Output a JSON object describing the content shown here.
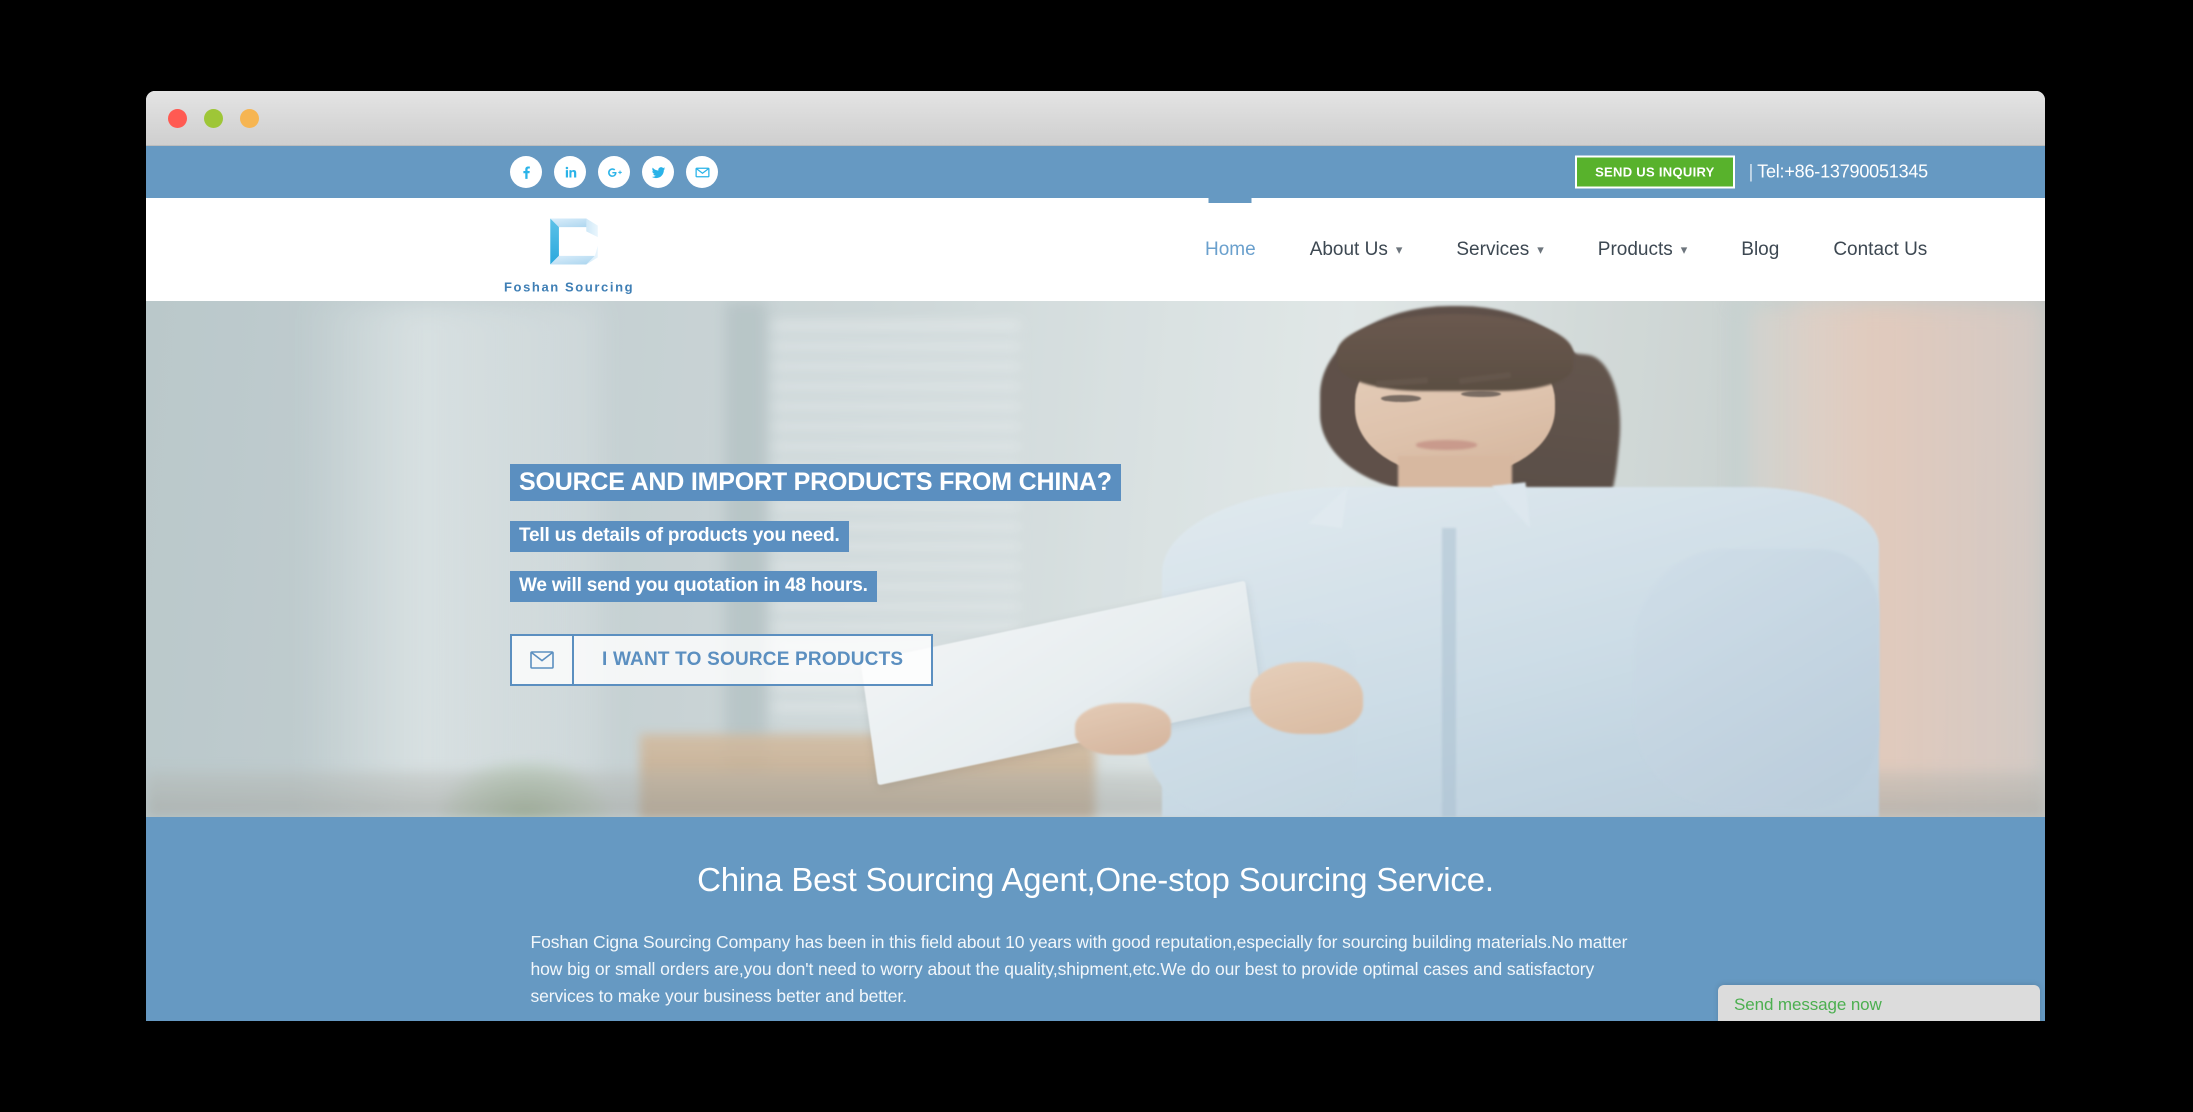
{
  "window": {
    "traffic_lights": [
      "close",
      "minimize",
      "maximize"
    ]
  },
  "topbar": {
    "social": [
      {
        "name": "facebook-icon",
        "label": "Facebook"
      },
      {
        "name": "linkedin-icon",
        "label": "LinkedIn"
      },
      {
        "name": "googleplus-icon",
        "label": "Google Plus"
      },
      {
        "name": "twitter-icon",
        "label": "Twitter"
      },
      {
        "name": "email-icon",
        "label": "Email"
      }
    ],
    "inquiry_button": "SEND US INQUIRY",
    "tel_separator": "|",
    "tel": "Tel:+86-13790051345"
  },
  "header": {
    "logo_text": "Foshan Sourcing",
    "nav": [
      {
        "label": "Home",
        "active": true,
        "dropdown": false
      },
      {
        "label": "About Us",
        "active": false,
        "dropdown": true
      },
      {
        "label": "Services",
        "active": false,
        "dropdown": true
      },
      {
        "label": "Products",
        "active": false,
        "dropdown": true
      },
      {
        "label": "Blog",
        "active": false,
        "dropdown": false
      },
      {
        "label": "Contact Us",
        "active": false,
        "dropdown": false
      }
    ]
  },
  "hero": {
    "headline": "SOURCE AND IMPORT PRODUCTS FROM CHINA?",
    "subline_1": "Tell us details of products you need.",
    "subline_2": "We will send you quotation in 48 hours.",
    "cta_label": "I WANT TO SOURCE PRODUCTS",
    "cta_icon": "envelope-icon",
    "image_alt": "Businesswoman in light blue shirt holding a white tablet in a bright office"
  },
  "intro": {
    "title": "China Best Sourcing Agent,One-stop Sourcing Service.",
    "body": "Foshan Cigna Sourcing Company has been in this field about 10 years with good reputation,especially for sourcing building materials.No matter how big or small orders are,you don't need to worry about the quality,shipment,etc.We do our best to provide optimal cases and satisfactory services to make your business better and better."
  },
  "chat_widget": {
    "label": "Send message now"
  },
  "colors": {
    "brand_blue": "#6699c2",
    "highlight_blue": "#5b8fc0",
    "inquiry_green": "#58b22c",
    "chat_green": "#4caf50",
    "social_icon_blue": "#2ab3e8",
    "nav_text": "#3d4852",
    "nav_active": "#6aa0cd"
  }
}
